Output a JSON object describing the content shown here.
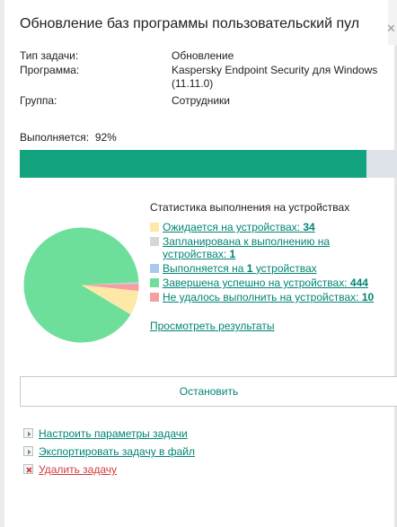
{
  "header": {
    "title": "Обновление баз программы пользовательский пул"
  },
  "info": {
    "task_type_label": "Тип задачи:",
    "task_type_value": "Обновление",
    "program_label": "Программа:",
    "program_value": "Kaspersky Endpoint Security для Windows (11.11.0)",
    "group_label": "Группа:",
    "group_value": "Сотрудники"
  },
  "progress": {
    "label": "Выполняется:",
    "percent_text": "92%",
    "fraction": 0.92,
    "color": "#14a37f"
  },
  "stats": {
    "title": "Статистика выполнения на устройствах",
    "items": [
      {
        "label": "Ожидается на устройствах:",
        "count": "34",
        "value": 34,
        "color": "#fde8a8"
      },
      {
        "label": "Запланирована к выполнению на устройствах:",
        "count": "1",
        "value": 1,
        "color": "#d6d6d6"
      },
      {
        "label": "Выполняется на",
        "count": "1",
        "suffix": "устройствах",
        "value": 1,
        "color": "#a8c8f0"
      },
      {
        "label": "Завершена успешно на устройствах:",
        "count": "444",
        "value": 444,
        "color": "#6ddf9a"
      },
      {
        "label": "Не удалось выполнить на устройствах:",
        "count": "10",
        "value": 10,
        "color": "#f5a0a0"
      }
    ],
    "results_link": "Просмотреть результаты"
  },
  "stop_button": "Остановить",
  "actions": {
    "configure": "Настроить параметры задачи",
    "export": "Экспортировать задачу в файл",
    "delete": "Удалить задачу"
  },
  "colors": {
    "link": "#008575",
    "danger": "#d33c3c"
  }
}
